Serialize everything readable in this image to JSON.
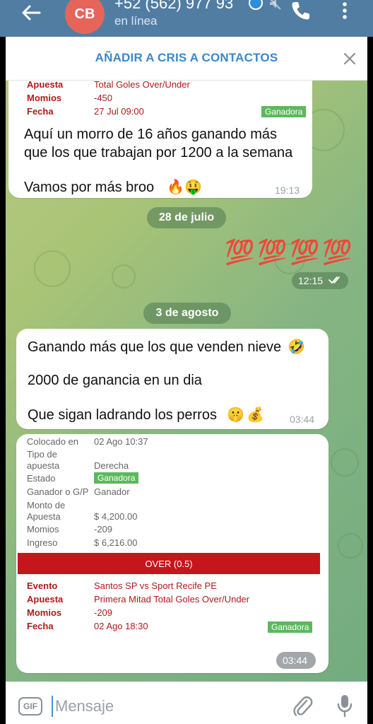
{
  "header": {
    "avatar_initials": "CB",
    "name": "+52 (562) 977 93",
    "status": "en línea",
    "colors": {
      "bar": "#527da3",
      "avatar": "#e5655a"
    }
  },
  "add_contact": {
    "label": "AÑADIR A CRIS A CONTACTOS",
    "color": "#3b88c9"
  },
  "msg1": {
    "fields": [
      {
        "label": "Apuesta",
        "value": "Total Goles Over/Under"
      },
      {
        "label": "Momios",
        "value": "-450"
      },
      {
        "label": "Fecha",
        "value": "27 Jul 09:00"
      }
    ],
    "badge": "Ganadora",
    "line1": "Aquí un morro de 16 años ganando más",
    "line2": "que los que trabajan por 1200 a la semana",
    "line3": "Vamos por más broo",
    "emoji1": "🔥",
    "emoji2": "🤑",
    "time": "19:13"
  },
  "date1": "28 de julio",
  "msg2": {
    "emoji": "💯",
    "count": 4,
    "time": "12:15",
    "read_icon": "double-check-icon"
  },
  "date2": "3 de agosto",
  "msg3": {
    "line1": "Ganando más que los que venden nieve",
    "emoji1": "🤣",
    "line2": "2000 de ganancia en un dia",
    "line3": "Que sigan ladrando los perros",
    "emoji2": "🤫",
    "emoji3": "💰",
    "time": "03:44"
  },
  "msg4": {
    "grey_fields": [
      {
        "label": "Colocado en",
        "value": "02 Ago 10:37"
      },
      {
        "label": "Tipo de",
        "label2": "apuesta",
        "value": "Derecha"
      },
      {
        "label": "Estado",
        "value": "Ganadora"
      },
      {
        "label": "Ganador o G/P",
        "value": "Ganador"
      },
      {
        "label": "Monto de",
        "label2": "Apuesta",
        "value": "$ 4,200.00"
      },
      {
        "label": "Momios",
        "value": "-209"
      },
      {
        "label": "Ingreso",
        "value": "$ 6,216.00"
      }
    ],
    "banner": "OVER (0.5)",
    "red_fields": [
      {
        "label": "Evento",
        "value": "Santos SP vs Sport Recife PE"
      },
      {
        "label": "Apuesta",
        "value": "Primera Mitad Total Goles Over/Under"
      },
      {
        "label": "Momios",
        "value": "-209"
      },
      {
        "label": "Fecha",
        "value": "02 Ago 18:30"
      }
    ],
    "badge": "Ganadora",
    "time": "03:44",
    "colors": {
      "banner": "#c4161c",
      "badge": "#5cb85c"
    }
  },
  "input": {
    "gif_label": "GIF",
    "placeholder": "Mensaje"
  }
}
